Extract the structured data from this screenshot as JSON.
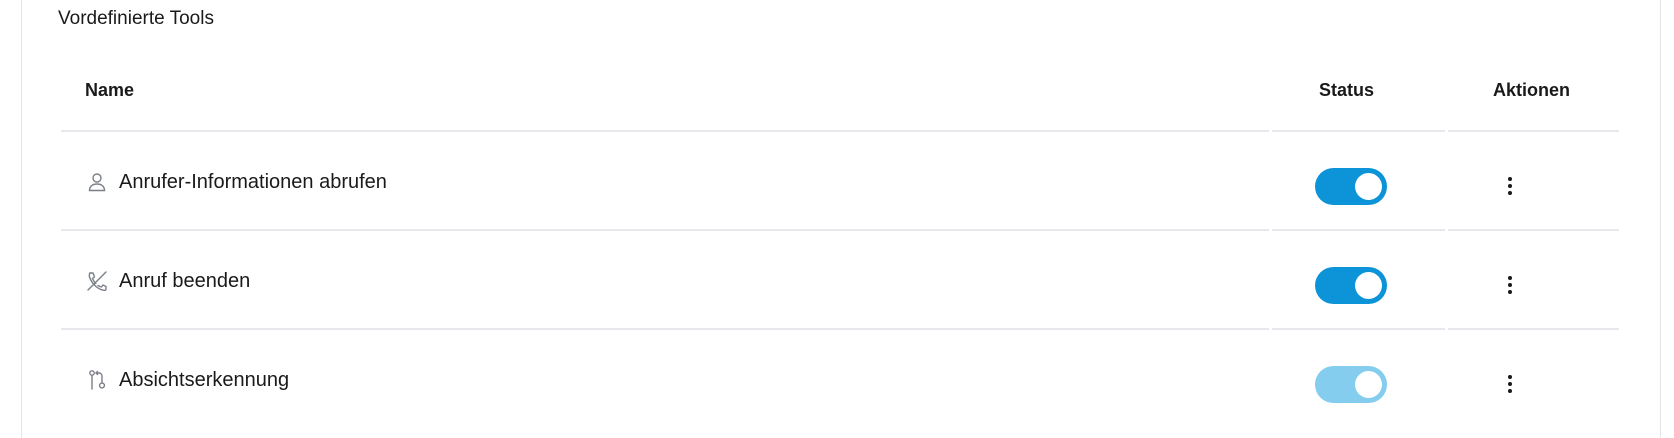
{
  "section": {
    "title": "Vordefinierte Tools"
  },
  "table": {
    "columns": {
      "name": "Name",
      "status": "Status",
      "actions": "Aktionen"
    },
    "rows": [
      {
        "name": "Anrufer-Informationen abrufen",
        "icon": "user-icon",
        "status_enabled": true,
        "status_disabled_control": false
      },
      {
        "name": "Anruf beenden",
        "icon": "phone-hangup-icon",
        "status_enabled": true,
        "status_disabled_control": false
      },
      {
        "name": "Absichtserkennung",
        "icon": "branch-icon",
        "status_enabled": true,
        "status_disabled_control": true
      }
    ]
  },
  "colors": {
    "toggle_on": "#0d93d8",
    "toggle_on_disabled": "#85cdef",
    "border": "#e6e8ec",
    "text": "#1a1a1a",
    "icon": "#7a7f87"
  }
}
